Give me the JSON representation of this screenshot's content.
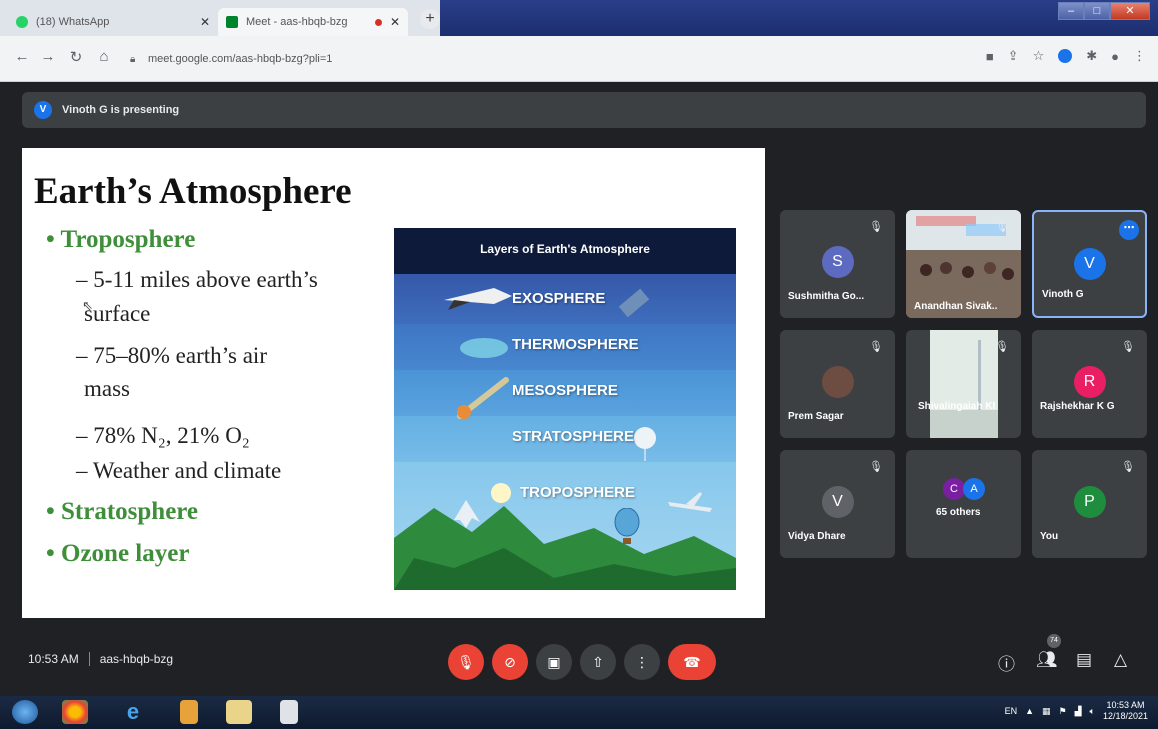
{
  "browser": {
    "tabs": [
      {
        "title": "(18) WhatsApp",
        "color": "#25d366"
      },
      {
        "title": "Meet - aas-hbqb-bzg",
        "color": "#00832d"
      }
    ],
    "url": "meet.google.com/aas-hbqb-bzg?pli=1"
  },
  "meet": {
    "presenting": "Vinoth G is presenting",
    "presenter_initial": "V",
    "time": "10:53 AM",
    "code": "aas-hbqb-bzg",
    "participant_count": "74"
  },
  "slide": {
    "title": "Earth’s Atmosphere",
    "bullets": {
      "troposphere": "• Troposphere",
      "sub1a": "– 5-11 miles above earth’s",
      "sub1b": "surface",
      "sub2a": "– 75–80% earth’s air",
      "sub2b": "mass",
      "sub3": "– 78% N₂, 21% O₂",
      "sub4": "– Weather and climate",
      "stratosphere": "• Stratosphere",
      "ozone": "• Ozone layer"
    },
    "infographic": {
      "title": "Layers of Earth's Atmosphere",
      "layers": [
        "EXOSPHERE",
        "THERMOSPHERE",
        "MESOSPHERE",
        "STRATOSPHERE",
        "TROPOSPHERE"
      ]
    }
  },
  "participants": [
    {
      "name": "Sushmitha Go...",
      "initial": "S",
      "color": "#5c6bc0"
    },
    {
      "name": "Anandhan Sivak..",
      "initial": "",
      "color": ""
    },
    {
      "name": "Vinoth G",
      "initial": "V",
      "color": "#1a73e8"
    },
    {
      "name": "Prem Sagar",
      "initial": "",
      "color": ""
    },
    {
      "name": "Shivalingaiah KI",
      "initial": "",
      "color": ""
    },
    {
      "name": "Rajshekhar K G",
      "initial": "R",
      "color": "#e91e63"
    },
    {
      "name": "Vidya Dhare",
      "initial": "V",
      "color": "#5f6368"
    },
    {
      "name": "65 others",
      "initial": "C",
      "initial2": "A",
      "color": "#7b1fa2"
    },
    {
      "name": "You",
      "initial": "P",
      "color": "#1e8e3e"
    }
  ],
  "taskbar": {
    "lang": "EN",
    "time": "10:53 AM",
    "date": "12/18/2021"
  }
}
